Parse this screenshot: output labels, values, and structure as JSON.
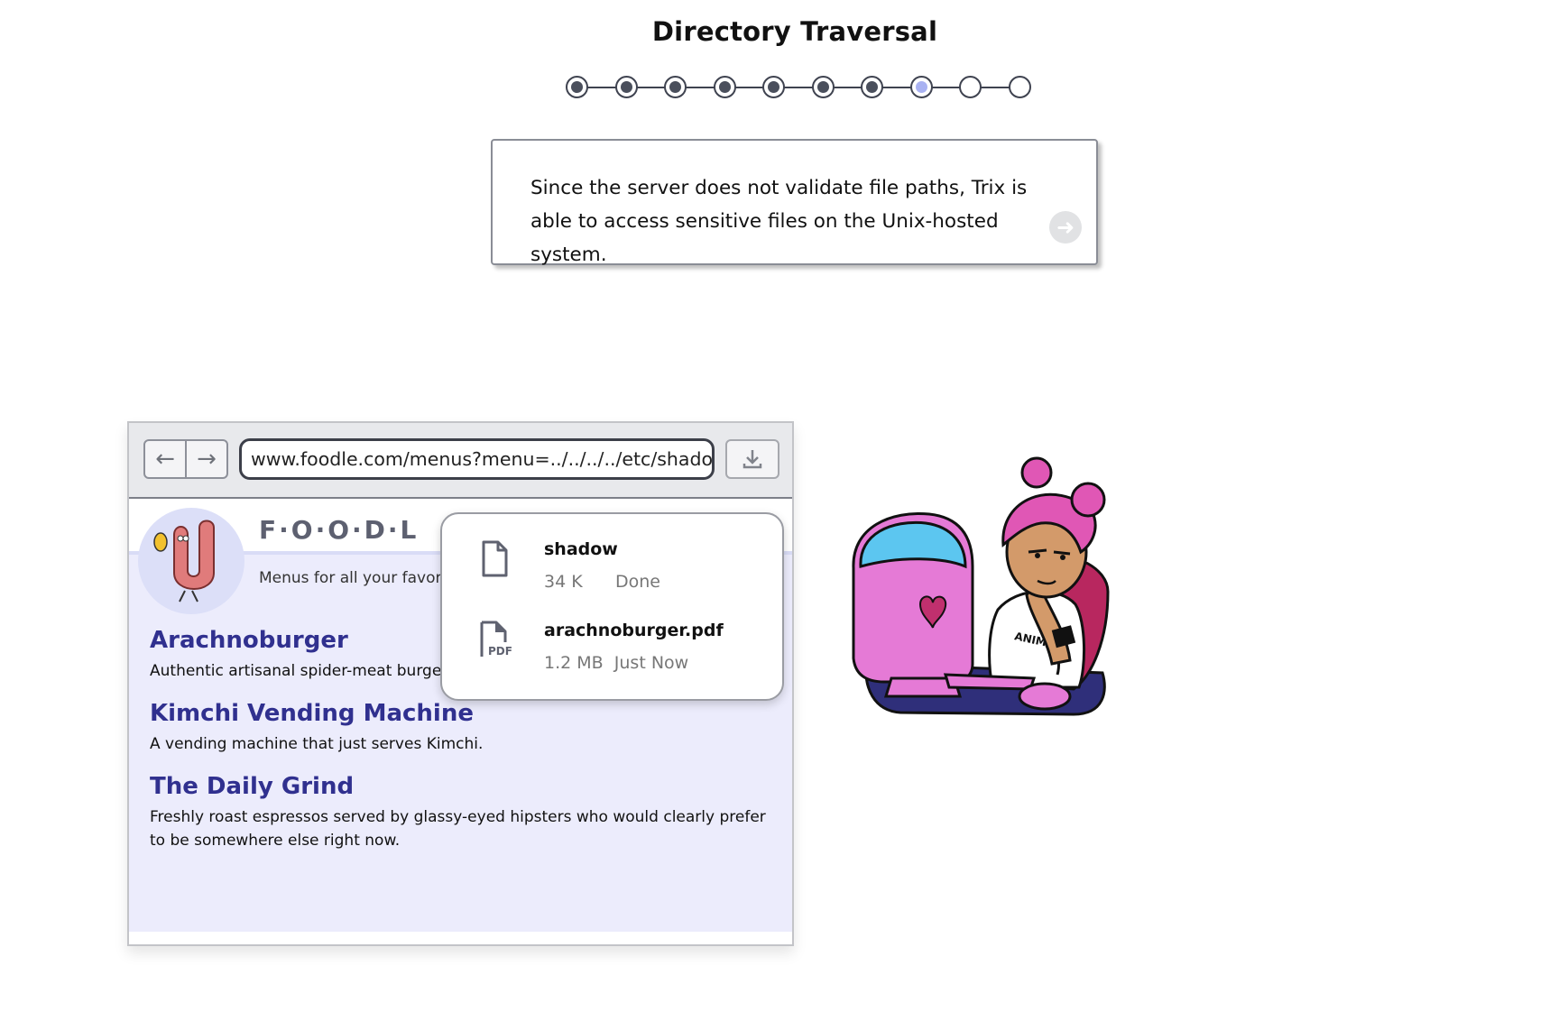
{
  "title": "Directory Traversal",
  "progress": {
    "steps": [
      "done",
      "done",
      "done",
      "done",
      "done",
      "done",
      "done",
      "current",
      "todo",
      "todo"
    ]
  },
  "dialog": {
    "text": "Since the server does not validate file paths, Trix is able to access sensitive files on the Unix-hosted system."
  },
  "browser": {
    "url": "www.foodle.com/menus?menu=../../../../etc/shadow",
    "site": {
      "brand": "F·O·O·D·L",
      "tagline": "Menus for all your favori",
      "restaurants": [
        {
          "name": "Arachnoburger",
          "desc": "Authentic artisanal spider-meat burgers"
        },
        {
          "name": "Kimchi Vending Machine",
          "desc": "A vending machine that just serves Kimchi."
        },
        {
          "name": "The Daily Grind",
          "desc": "Freshly roast espressos served by glassy-eyed hipsters who would clearly prefer to be somewhere else right now."
        }
      ]
    },
    "downloads": [
      {
        "file": "shadow",
        "size": "34 K",
        "status": "Done",
        "icon": "file-icon"
      },
      {
        "file": "arachnoburger.pdf",
        "size": "1.2 MB",
        "status": "Just Now",
        "icon": "pdf-file-icon"
      }
    ]
  },
  "colors": {
    "accent": "#30308f",
    "current_step": "#a9b2f2",
    "page_bg": "#ececfc"
  }
}
